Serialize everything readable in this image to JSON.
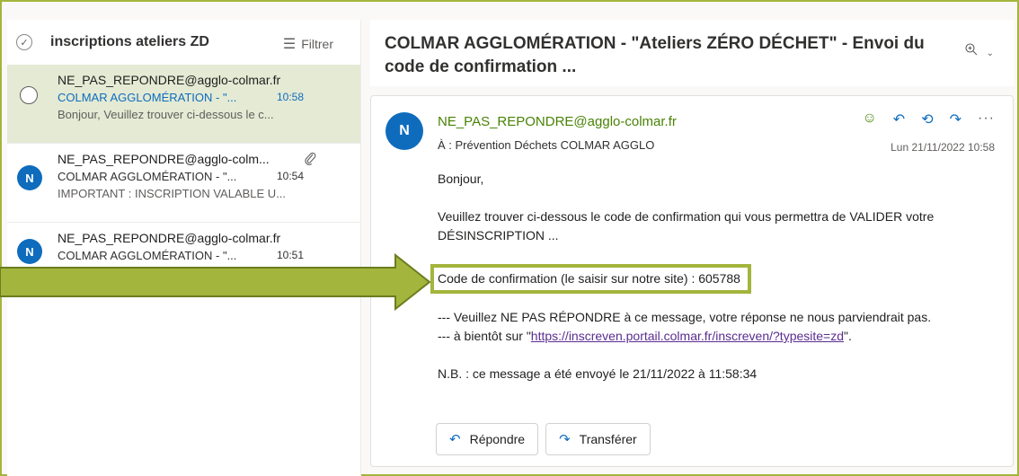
{
  "folder": {
    "title": "inscriptions ateliers ZD",
    "filter_label": "Filtrer"
  },
  "mail_list": [
    {
      "from": "NE_PAS_REPONDRE@agglo-colmar.fr",
      "subject": "COLMAR AGGLOMÉRATION - \"...",
      "time": "10:58",
      "preview": "Bonjour, Veuillez trouver ci-dessous le c..."
    },
    {
      "from": "NE_PAS_REPONDRE@agglo-colm...",
      "subject": "COLMAR AGGLOMÉRATION - \"...",
      "time": "10:54",
      "preview": "IMPORTANT : INSCRIPTION VALABLE U...",
      "avatar": "N"
    },
    {
      "from": "NE_PAS_REPONDRE@agglo-colmar.fr",
      "subject": "COLMAR AGGLOMÉRATION - \"...",
      "time": "10:51",
      "avatar": "N"
    }
  ],
  "reading": {
    "conversation_title": "COLMAR AGGLOMÉRATION - \"Ateliers ZÉRO DÉCHET\" - Envoi du code de confirmation ...",
    "avatar": "N",
    "sender": "NE_PAS_REPONDRE@agglo-colmar.fr",
    "to": "À :  Prévention Déchets COLMAR AGGLO",
    "date": "Lun 21/11/2022 10:58",
    "greeting": "Bonjour,",
    "para1": "Veuillez trouver ci-dessous le code de confirmation qui vous permettra de VALIDER votre DÉSINSCRIPTION ...",
    "code_line": "Code de confirmation (le saisir sur notre site)  : 605788",
    "para3": "--- Veuillez NE PAS RÉPONDRE à ce message, votre réponse ne nous parviendrait pas.",
    "para4_prefix": "--- à bientôt sur \"",
    "link": "https://inscreven.portail.colmar.fr/inscreven/?typesite=zd",
    "para4_suffix": "\".",
    "nb": "N.B. : ce message a été envoyé le 21/11/2022 à 11:58:34",
    "reply_label": "Répondre",
    "forward_label": "Transférer"
  },
  "colors": {
    "accent_green": "#a3b53c",
    "selected_bg": "#e4ead4",
    "link": "#5b2c91",
    "brand_blue": "#0f6cbd"
  }
}
